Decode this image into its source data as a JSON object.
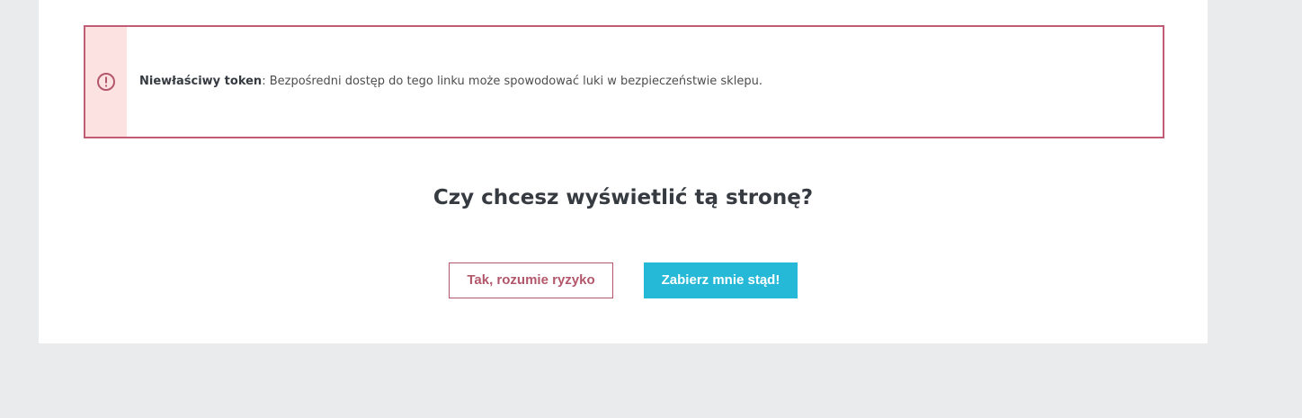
{
  "alert": {
    "icon": "alert-circle-icon",
    "title": "Niewłaściwy token",
    "separator": ":",
    "message": " Bezpośredni dostęp do tego linku może spowodować luki w bezpieczeństwie sklepu.",
    "border_color": "#c05c73",
    "icon_bg_color": "#fde2e2"
  },
  "question": "Czy chcesz wyświetlić tą stronę?",
  "buttons": {
    "accept_risk": "Tak, rozumie ryzyko",
    "leave": "Zabierz mnie stąd!"
  },
  "colors": {
    "page_bg": "#eaebec",
    "accent": "#25b9d7",
    "danger": "#b3576a"
  }
}
